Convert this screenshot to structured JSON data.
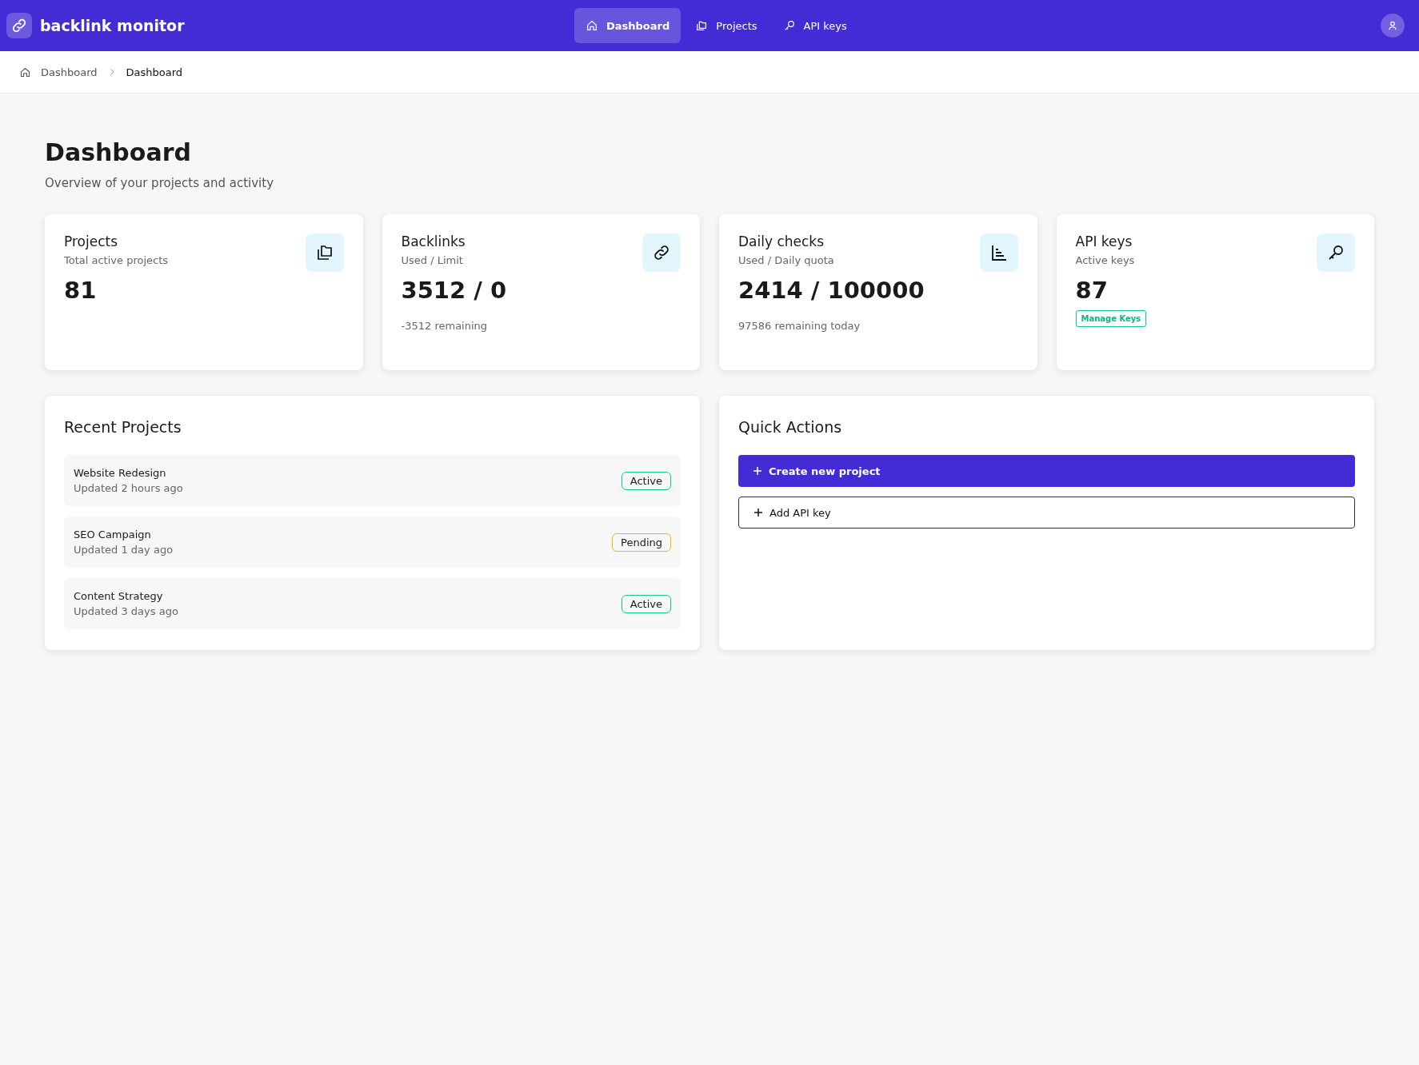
{
  "app": {
    "title": "backlink monitor"
  },
  "nav": [
    {
      "label": "Dashboard",
      "kind": "home",
      "selected": true
    },
    {
      "label": "Projects",
      "kind": "folders",
      "selected": false
    },
    {
      "label": "API keys",
      "kind": "key",
      "selected": false
    }
  ],
  "breadcrumb": [
    "Dashboard",
    "Dashboard"
  ],
  "page": {
    "title": "Dashboard",
    "subtitle": "Overview of your projects and activity"
  },
  "stats": [
    {
      "title": "Projects",
      "subtitle": "Total active projects",
      "value": "81",
      "kind": "folders"
    },
    {
      "title": "Backlinks",
      "subtitle": "Used / Limit",
      "value": "3512 / 0",
      "note": "-3512 remaining",
      "kind": "link"
    },
    {
      "title": "Daily checks",
      "subtitle": "Used / Daily quota",
      "value": "2414 / 100000",
      "note": "97586 remaining today",
      "kind": "chart"
    },
    {
      "title": "API keys",
      "subtitle": "Active keys",
      "value": "87",
      "action": "Manage Keys",
      "kind": "key"
    }
  ],
  "recent_projects": {
    "title": "Recent Projects",
    "items": [
      {
        "name": "Website Redesign",
        "updated": "Updated 2 hours ago",
        "status": "Active",
        "color": "#10c98f"
      },
      {
        "name": "SEO Campaign",
        "updated": "Updated 1 day ago",
        "status": "Pending",
        "color": "#f5b800"
      },
      {
        "name": "Content Strategy",
        "updated": "Updated 3 days ago",
        "status": "Active",
        "color": "#10c98f"
      }
    ]
  },
  "quick_actions": {
    "title": "Quick Actions",
    "buttons": [
      {
        "label": "Create new project",
        "kind": "primary"
      },
      {
        "label": "Add API key",
        "kind": "outline"
      }
    ]
  }
}
